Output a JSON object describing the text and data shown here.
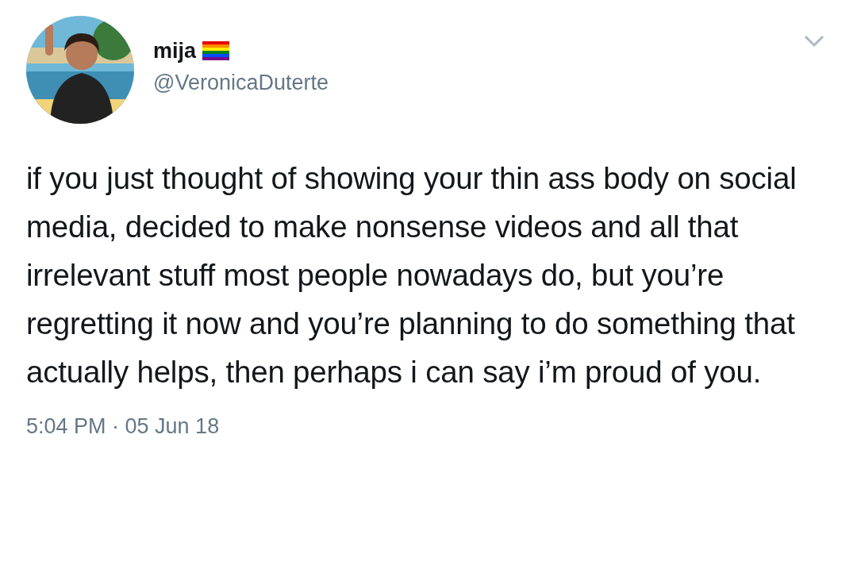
{
  "tweet": {
    "author": {
      "name": "mija",
      "handle": "@VeronicaDuterte"
    },
    "text": "if you just thought of showing your thin ass body on social media, decided to make nonsense videos and all that irrelevant stuff most people nowadays do, but you’re regretting it now and you’re planning to do something that actually helps, then perhaps i can say i’m proud of you.",
    "timestamp": "5:04 PM · 05 Jun 18"
  }
}
